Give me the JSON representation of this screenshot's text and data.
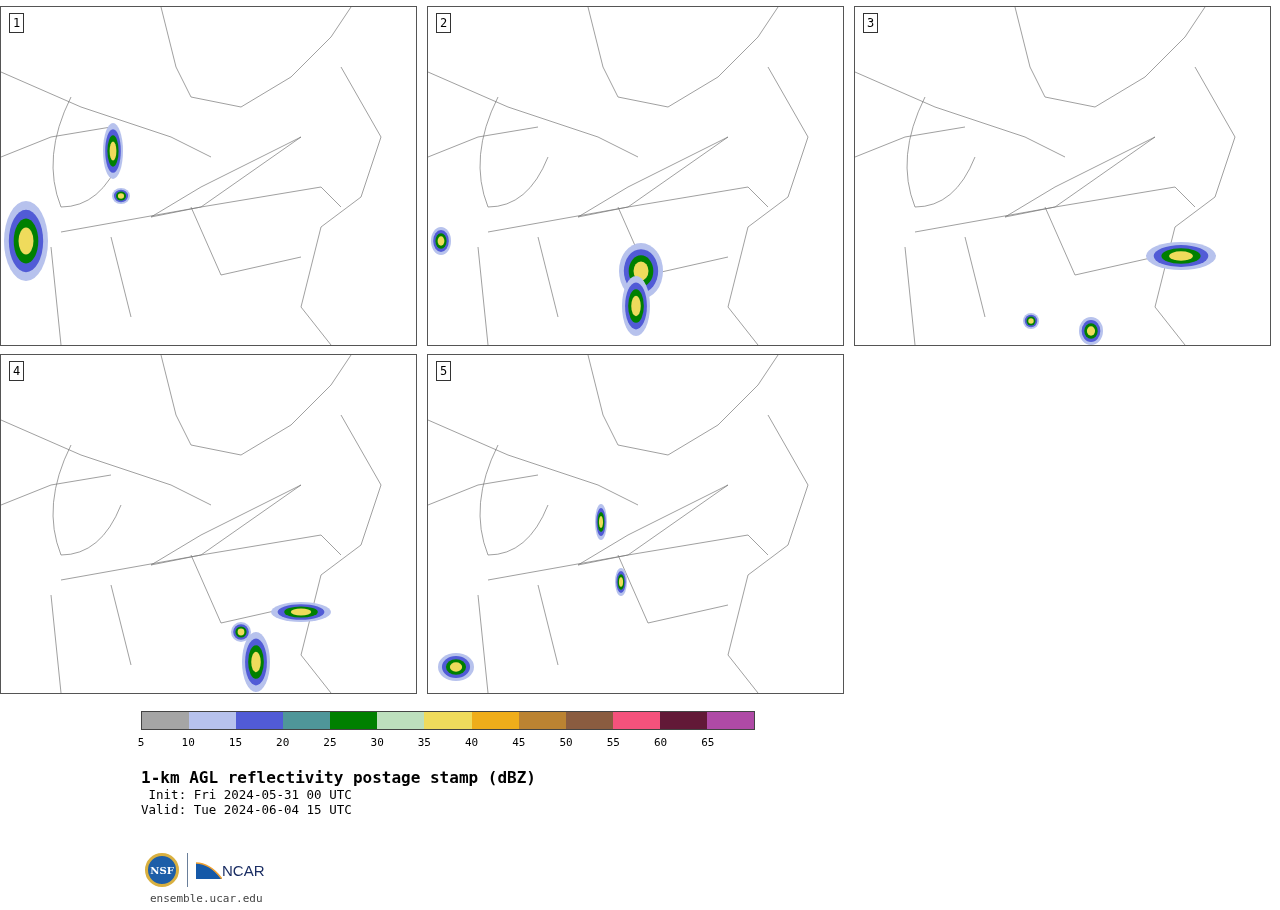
{
  "panels": [
    {
      "label": "1"
    },
    {
      "label": "2"
    },
    {
      "label": "3"
    },
    {
      "label": "4"
    },
    {
      "label": "5"
    }
  ],
  "colorbar": {
    "bins": [
      {
        "color": "#a5a5a5"
      },
      {
        "color": "#b7c2ed"
      },
      {
        "color": "#515bd6"
      },
      {
        "color": "#4f9699"
      },
      {
        "color": "#008000"
      },
      {
        "color": "#bddfbd"
      },
      {
        "color": "#efdb5c"
      },
      {
        "color": "#efad1a"
      },
      {
        "color": "#bb8332"
      },
      {
        "color": "#8a5c40"
      },
      {
        "color": "#f5527c"
      },
      {
        "color": "#621937"
      },
      {
        "color": "#af4aa6"
      }
    ],
    "ticks": [
      "5",
      "10",
      "15",
      "20",
      "25",
      "30",
      "35",
      "40",
      "45",
      "50",
      "55",
      "60",
      "65"
    ]
  },
  "title": "1-km AGL reflectivity postage stamp (dBZ)",
  "init": " Init: Fri 2024-05-31 00 UTC",
  "valid": "Valid: Tue 2024-06-04 15 UTC",
  "logo": {
    "left": "NSF",
    "right": "NCAR"
  },
  "url": "ensemble.ucar.edu"
}
